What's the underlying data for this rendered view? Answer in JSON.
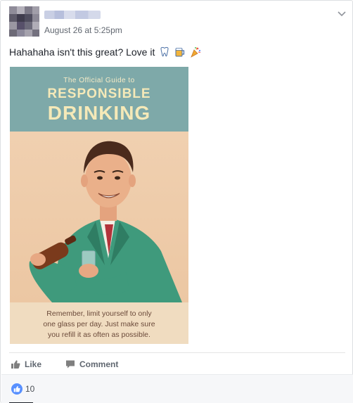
{
  "post": {
    "timestamp": "August 26 at 5:25pm",
    "text": "Hahahaha isn't this great? Love it",
    "emoji_icons": [
      "tooth-icon",
      "beer-mug-icon",
      "party-popper-icon"
    ]
  },
  "image": {
    "kicker": "The Official Guide to",
    "title_line1": "RESPONSIBLE",
    "title_line2": "DRINKING",
    "caption_line1": "Remember, limit yourself to only",
    "caption_line2": "one glass per day. Just make sure",
    "caption_line3": "you refill it as often as possible."
  },
  "actions": {
    "like_label": "Like",
    "comment_label": "Comment"
  },
  "reactions": {
    "count": "10",
    "icon": "thumbs-up-icon"
  },
  "colors": {
    "facebook_blue": "#5890ff",
    "poster_teal": "#7ea9a9",
    "poster_cream": "#f5e9b8"
  }
}
